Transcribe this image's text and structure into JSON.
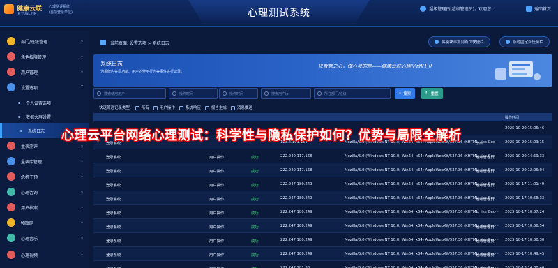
{
  "header": {
    "logo_name": "健康云联",
    "logo_sub": "JK YUNLINK",
    "system_small_line1": "心理测评系统",
    "system_small_line2": "(当前登录单位)",
    "title": "心理测试系统",
    "user_text": "超级管理员[超级管理员]，欢迎您！",
    "home_text": "返回首页"
  },
  "sidebar": {
    "items": [
      {
        "label": "部门/班级管理",
        "icon": "department-icon",
        "color": "#f0b429",
        "caret": "⌄"
      },
      {
        "label": "角色权限管理",
        "icon": "role-icon",
        "color": "#e25c5c",
        "caret": "⌄"
      },
      {
        "label": "用户管理",
        "icon": "user-icon",
        "color": "#e25c5c",
        "caret": "⌄"
      },
      {
        "label": "设置选项",
        "icon": "settings-icon",
        "color": "#4a8fe8",
        "caret": "⌃"
      },
      {
        "label": "个人设置选项",
        "sub": true
      },
      {
        "label": "数据大屏设置",
        "sub": true
      },
      {
        "label": "系统日志",
        "sub": true,
        "active": true
      },
      {
        "label": "量表测评",
        "icon": "scale-icon",
        "color": "#e25c5c",
        "caret": "⌄"
      },
      {
        "label": "量表库管理",
        "icon": "library-icon",
        "color": "#4a8fe8",
        "caret": "⌄"
      },
      {
        "label": "危机干预",
        "icon": "crisis-icon",
        "color": "#e25c5c",
        "caret": "⌄"
      },
      {
        "label": "心理咨询",
        "icon": "consult-icon",
        "color": "#3fb8a8",
        "caret": "⌄"
      },
      {
        "label": "用户档案",
        "icon": "profile-icon",
        "color": "#e25c5c",
        "caret": "⌄"
      },
      {
        "label": "物联网",
        "icon": "iot-icon",
        "color": "#f0b429",
        "caret": "⌄"
      },
      {
        "label": "心理音乐",
        "icon": "music-icon",
        "color": "#3fb8a8",
        "caret": "⌄"
      },
      {
        "label": "心理视频",
        "icon": "video-icon",
        "color": "#e25c5c",
        "caret": "⌄"
      }
    ]
  },
  "breadcrumb": "当前页面: 设置选项 > 系统日志",
  "shortcut_btn": "将模块添加到首页快捷栏",
  "pin_btn": "临时固定到任务栏",
  "banner": {
    "title": "系统日志",
    "desc": "为系统内各项功能、用户的使用行为等事件进行记录。",
    "slogan": "以智慧之心，做心灵的岸——健康云联心理平台V1.0"
  },
  "filters": {
    "user_placeholder": "搜索使用用户",
    "start_placeholder": "操作时间",
    "end_placeholder": "操作时间",
    "ip_placeholder": "搜索用户ip",
    "dept_placeholder": "所在部门/班级",
    "search_label": "搜索",
    "reset_label": "重置"
  },
  "quick_filter": {
    "label": "快速筛选记录类型:",
    "options": [
      "所有",
      "用户操作",
      "系统响应",
      "报告生成",
      "消息推送"
    ]
  },
  "table": {
    "headers": [
      "",
      "",
      "",
      "",
      "",
      "",
      "操作时间"
    ],
    "rows": [
      {
        "module": "",
        "type": "",
        "result": "",
        "ip": "",
        "ua": "",
        "user": "",
        "time": "2025-10-20 15:06:46"
      },
      {
        "module": "登录系统",
        "type": "",
        "result": "",
        "ip": "123.4.101.154",
        "ua": "Mozilla/5.0 (Windows NT 10.0; Win64; x64) AppleWebKit/537.36 (KHTML, like Gec···",
        "user": "李欣",
        "time": "2025-10-20 15:03:15"
      },
      {
        "module": "登录系统",
        "type": "用户操作",
        "result": "成功",
        "ip": "222.240.117.168",
        "ua": "Mozilla/5.0 (Windows NT 10.0; Win64; x64) AppleWebKit/537.36 (KHTML, like Gec···",
        "user": "超级管理员",
        "time": "2025-10-20 14:59:33"
      },
      {
        "module": "登录系统",
        "type": "用户操作",
        "result": "成功",
        "ip": "222.240.117.168",
        "ua": "Mozilla/5.0 (Windows NT 10.0; Win64; x64) AppleWebKit/537.36 (KHTML, like Gec···",
        "user": "超级管理员",
        "time": "2025-10-20 12:06:04"
      },
      {
        "module": "登录系统",
        "type": "用户操作",
        "result": "成功",
        "ip": "222.247.180.249",
        "ua": "Mozilla/5.0 (Windows NT 10.0; Win64; x64) AppleWebKit/537.36 (KHTML, like Gec···",
        "user": "超级管理员",
        "time": "2025-10-17 11:01:49"
      },
      {
        "module": "登录系统",
        "type": "用户操作",
        "result": "成功",
        "ip": "222.247.180.249",
        "ua": "Mozilla/5.0 (Windows NT 10.0; Win64; x64) AppleWebKit/537.36 (KHTML, like Gec···",
        "user": "超级管理员",
        "time": "2025-10-17 10:58:33"
      },
      {
        "module": "登录系统",
        "type": "用户操作",
        "result": "成功",
        "ip": "222.247.180.249",
        "ua": "Mozilla/5.0 (Windows NT 10.0; Win64; x64) AppleWebKit/537.36 (KHTML, like Gec···",
        "user": "–",
        "time": "2025-10-17 10:57:24"
      },
      {
        "module": "登录系统",
        "type": "用户操作",
        "result": "成功",
        "ip": "222.247.180.249",
        "ua": "Mozilla/5.0 (Windows NT 10.0; Win64; x64) AppleWebKit/537.36 (KHTML, like Gec···",
        "user": "超级管理员",
        "time": "2025-10-17 10:56:54"
      },
      {
        "module": "登录系统",
        "type": "用户操作",
        "result": "成功",
        "ip": "222.247.180.249",
        "ua": "Mozilla/5.0 (Windows NT 10.0; Win64; x64) AppleWebKit/537.36 (KHTML, like Gec···",
        "user": "超级管理员",
        "time": "2025-10-17 10:50:30"
      },
      {
        "module": "登录系统",
        "type": "用户操作",
        "result": "成功",
        "ip": "222.247.180.249",
        "ua": "Mozilla/5.0 (Windows NT 10.0; Win64; x64) AppleWebKit/537.36 (KHTML, like Gec···",
        "user": "超级管理员",
        "time": "2025-10-17 10:49:45"
      },
      {
        "module": "登录系统",
        "type": "用户操作",
        "result": "成功",
        "ip": "222.247.181.38",
        "ua": "Mozilla/5.0 (Windows NT 10.0; Win64; x64) AppleWebKit/537.36 (KHTML, like Gec···",
        "user": "超级管理员",
        "time": "2025-10-13 14:30:46"
      }
    ]
  },
  "overlay_headline": "心理云平台网络心理测试：科学性与隐私保护如何？优势与局限全解析"
}
